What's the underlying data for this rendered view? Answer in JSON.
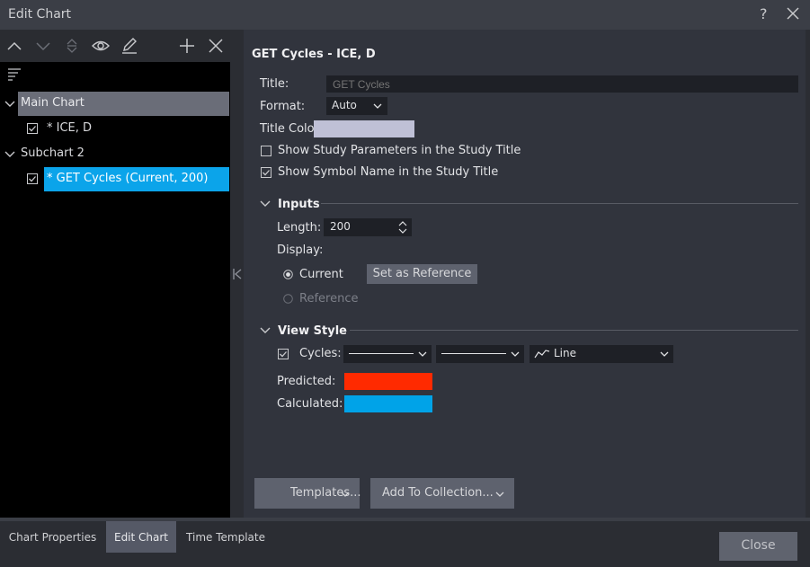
{
  "window": {
    "title": "Edit Chart",
    "help_label": "?"
  },
  "tree": {
    "main_chart": "Main Chart",
    "symbol": "* ICE, D",
    "subchart": "Subchart 2",
    "study": "* GET Cycles (Current, 200)"
  },
  "study": {
    "header": "GET Cycles - ICE, D",
    "title_label": "Title:",
    "title_placeholder": "GET Cycles",
    "format_label": "Format:",
    "format_value": "Auto",
    "title_color_label": "Title Color:",
    "title_color": "#bfc0d6",
    "show_params_label": "Show Study Parameters in the Study Title",
    "show_params_checked": false,
    "show_symbol_label": "Show Symbol Name in the Study Title",
    "show_symbol_checked": true
  },
  "inputs": {
    "section_label": "Inputs",
    "length_label": "Length:",
    "length_value": "200",
    "display_label": "Display:",
    "current_label": "Current",
    "current_selected": true,
    "set_reference_label": "Set as Reference",
    "reference_label": "Reference",
    "reference_enabled": false
  },
  "view_style": {
    "section_label": "View Style",
    "cycles_label": "Cycles:",
    "cycles_checked": true,
    "line_type_value": "Line",
    "predicted_label": "Predicted:",
    "predicted_color": "#ff2a00",
    "calculated_label": "Calculated:",
    "calculated_color": "#00a3e8"
  },
  "footer_buttons": {
    "templates_label": "Templates...",
    "add_collection_label": "Add To Collection..."
  },
  "bottom_tabs": [
    {
      "label": "Chart Properties",
      "active": false
    },
    {
      "label": "Edit Chart",
      "active": true
    },
    {
      "label": "Time Template",
      "active": false
    }
  ],
  "close_label": "Close"
}
